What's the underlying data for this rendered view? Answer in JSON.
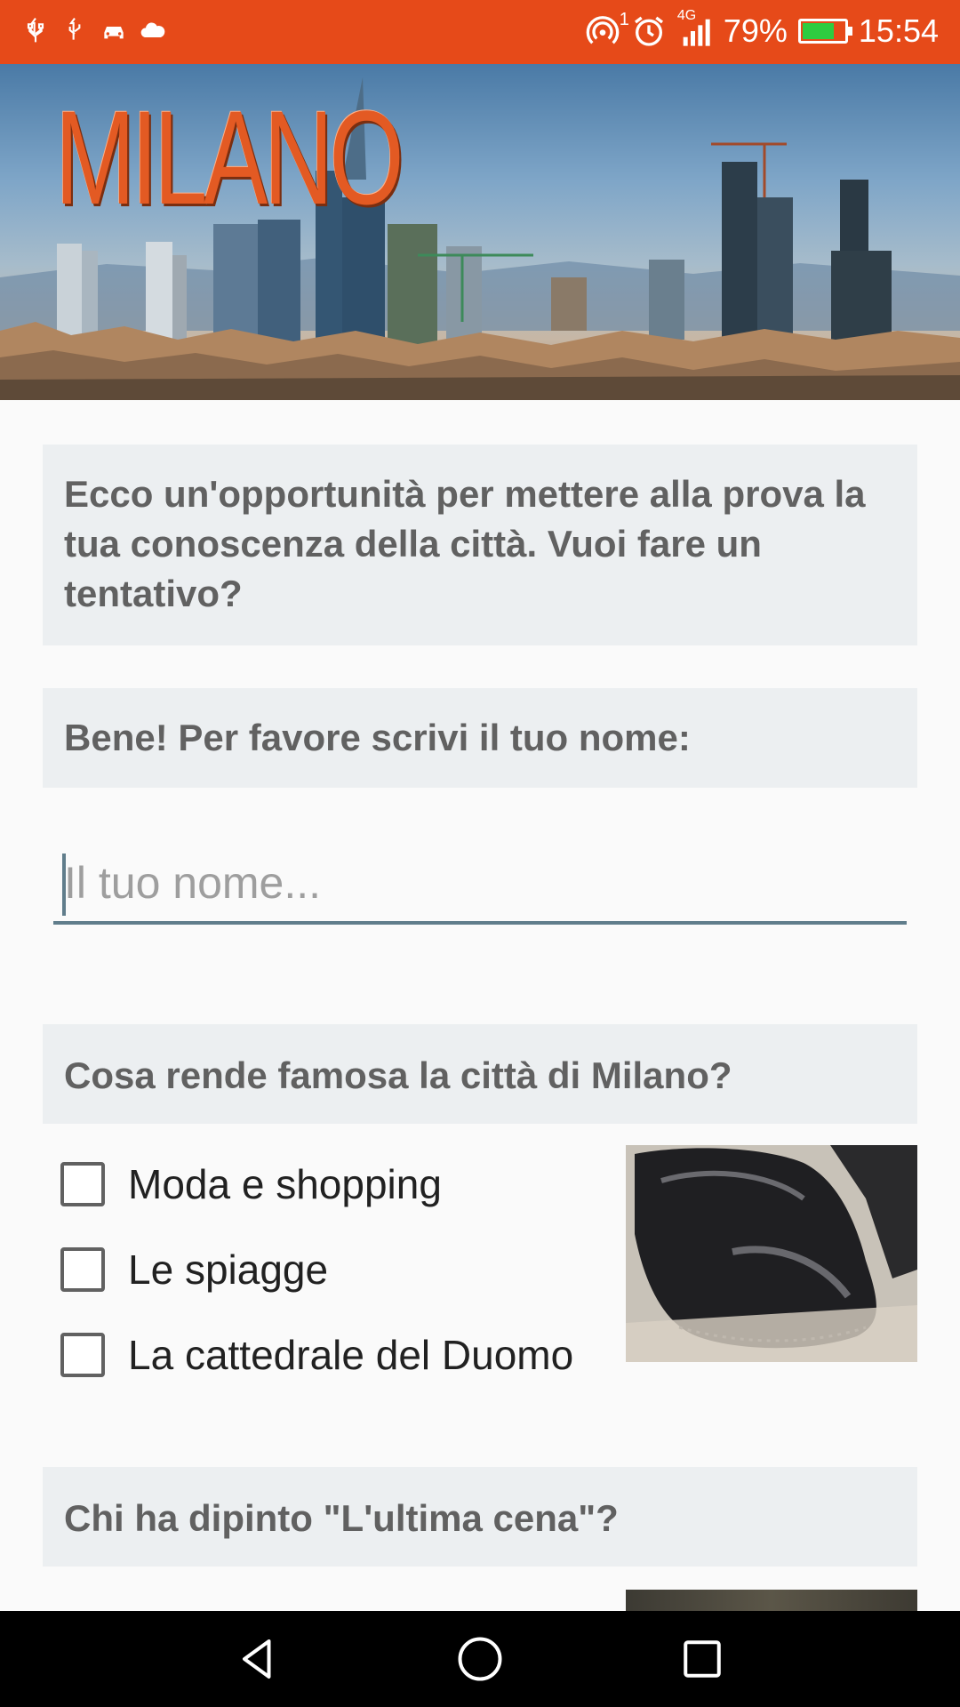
{
  "status_bar": {
    "left_icons": [
      "usb-icon",
      "usb-icon",
      "car-icon",
      "cloud-icon"
    ],
    "right_icons": [
      "hotspot-icon",
      "alarm-icon",
      "signal-4g-icon",
      "battery-icon"
    ],
    "hotspot_count": "1",
    "network_label": "4G",
    "battery": "79%",
    "battery_level": 0.79,
    "time": "15:54",
    "accent": "#e64a19"
  },
  "banner": {
    "title": "MILANO"
  },
  "intro": {
    "text": "Ecco un'opportunità per mettere alla prova la tua conoscenza della città. Vuoi fare un tentativo?"
  },
  "name_prompt": {
    "text": "Bene! Per favore scrivi il tuo nome:"
  },
  "name_input": {
    "value": "",
    "placeholder": "Il tuo nome..."
  },
  "question1": {
    "text": "Cosa rende famosa la città di Milano?",
    "options": [
      {
        "label": "Moda e shopping",
        "checked": false
      },
      {
        "label": "Le spiagge",
        "checked": false
      },
      {
        "label": "La cattedrale del Duomo",
        "checked": false
      }
    ],
    "image_icon": "shoe-image"
  },
  "question2": {
    "text": "Chi ha dipinto \"L'ultima cena\"?"
  },
  "nav": {
    "buttons": [
      "back-icon",
      "home-icon",
      "recents-icon"
    ]
  }
}
